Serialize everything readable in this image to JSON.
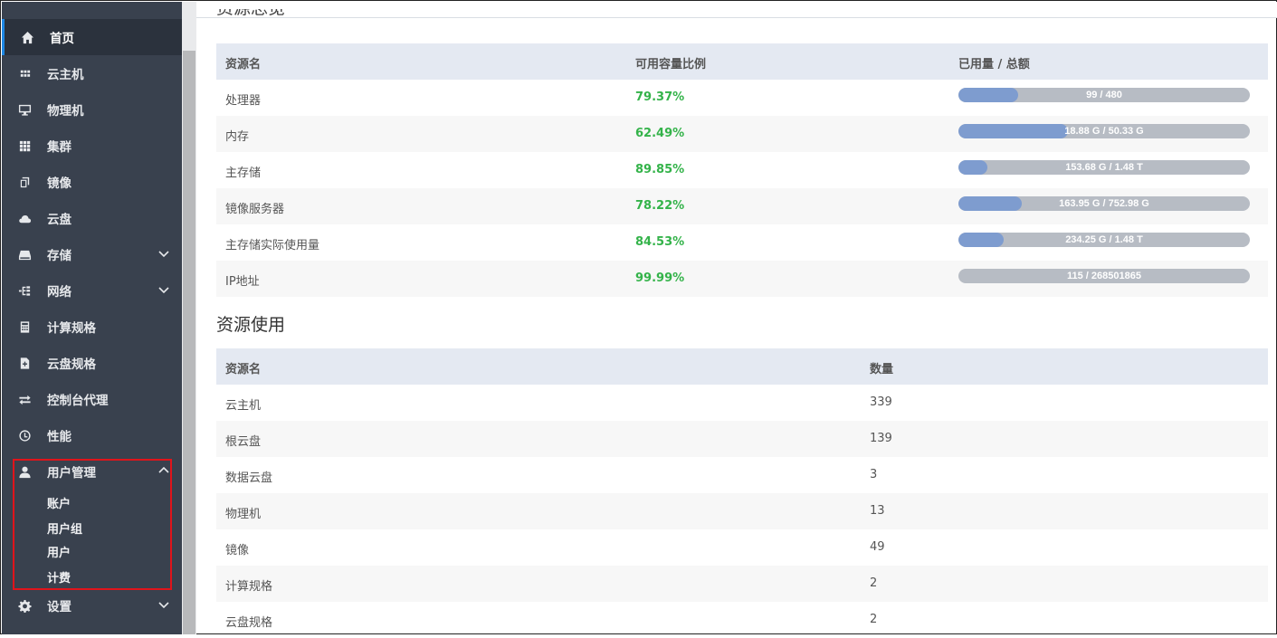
{
  "sidebar": {
    "items": [
      {
        "label": "首页",
        "icon": "home-icon"
      },
      {
        "label": "云主机",
        "icon": "grid-small-icon"
      },
      {
        "label": "物理机",
        "icon": "monitor-icon"
      },
      {
        "label": "集群",
        "icon": "grid-icon"
      },
      {
        "label": "镜像",
        "icon": "copy-icon"
      },
      {
        "label": "云盘",
        "icon": "cloud-icon"
      },
      {
        "label": "存储",
        "icon": "drive-icon"
      },
      {
        "label": "网络",
        "icon": "network-icon"
      },
      {
        "label": "计算规格",
        "icon": "calculator-icon"
      },
      {
        "label": "云盘规格",
        "icon": "disk-file-icon"
      },
      {
        "label": "控制台代理",
        "icon": "swap-icon"
      },
      {
        "label": "性能",
        "icon": "gauge-icon"
      },
      {
        "label": "用户管理",
        "icon": "user-icon"
      },
      {
        "label": "设置",
        "icon": "gear-icon"
      }
    ],
    "user_mgmt_sub": [
      "账户",
      "用户组",
      "用户",
      "计费"
    ]
  },
  "overview": {
    "title": "资源总览",
    "headers": [
      "资源名",
      "可用容量比例",
      "已用量 / 总额"
    ],
    "rows": [
      {
        "name": "处理器",
        "pct": "79.37%",
        "usage": "99 / 480",
        "fill": 0.206
      },
      {
        "name": "内存",
        "pct": "62.49%",
        "usage": "18.88 G / 50.33 G",
        "fill": 0.375
      },
      {
        "name": "主存储",
        "pct": "89.85%",
        "usage": "153.68 G / 1.48 T",
        "fill": 0.1
      },
      {
        "name": "镜像服务器",
        "pct": "78.22%",
        "usage": "163.95 G / 752.98 G",
        "fill": 0.218
      },
      {
        "name": "主存储实际使用量",
        "pct": "84.53%",
        "usage": "234.25 G / 1.48 T",
        "fill": 0.155
      },
      {
        "name": "IP地址",
        "pct": "99.99%",
        "usage": "115 / 268501865",
        "fill": 0.0
      }
    ]
  },
  "usage": {
    "title": "资源使用",
    "headers": [
      "资源名",
      "数量"
    ],
    "rows": [
      {
        "name": "云主机",
        "count": "339"
      },
      {
        "name": "根云盘",
        "count": "139"
      },
      {
        "name": "数据云盘",
        "count": "3"
      },
      {
        "name": "物理机",
        "count": "13"
      },
      {
        "name": "镜像",
        "count": "49"
      },
      {
        "name": "计算规格",
        "count": "2"
      },
      {
        "name": "云盘规格",
        "count": "2"
      }
    ]
  },
  "colors": {
    "sidebar": "#39414e",
    "accent": "#1e88e5",
    "green": "#34b34a",
    "bar_fill": "#7e9ccf",
    "bar_bg": "#b7bcc4",
    "highlight": "#e0141b"
  }
}
